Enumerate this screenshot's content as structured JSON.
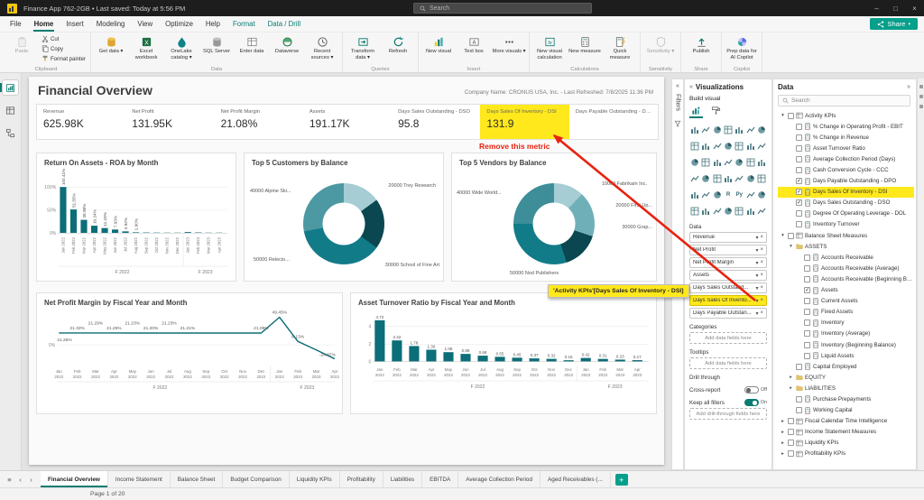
{
  "colors": {
    "accent": "#0a7c71",
    "share_button": "#069f8c",
    "highlight": "#ffe81c",
    "annotation": "#e8220f",
    "chart_main": "#0b6e78"
  },
  "titlebar": {
    "title": "Finance App 762-2GB • Last saved: Today at 5:56 PM",
    "search_placeholder": "Search"
  },
  "menubar": {
    "tabs": [
      {
        "label": "File"
      },
      {
        "label": "Home",
        "active": true
      },
      {
        "label": "Insert"
      },
      {
        "label": "Modeling"
      },
      {
        "label": "View"
      },
      {
        "label": "Optimize"
      },
      {
        "label": "Help"
      },
      {
        "label": "Format",
        "contextual": true
      },
      {
        "label": "Data / Drill",
        "contextual": true
      }
    ],
    "share_label": "Share"
  },
  "ribbon": {
    "groups": [
      {
        "label": "Clipboard",
        "items": [
          {
            "type": "big",
            "label": "Paste",
            "icon": "paste",
            "disabled": true
          },
          {
            "type": "small",
            "label": "Cut",
            "icon": "cut"
          },
          {
            "type": "small",
            "label": "Copy",
            "icon": "copy"
          },
          {
            "type": "small",
            "label": "Format painter",
            "icon": "format-painter"
          }
        ]
      },
      {
        "label": "Data",
        "items": [
          {
            "type": "big",
            "label": "Get data",
            "icon": "get-data",
            "dropdown": true
          },
          {
            "type": "big",
            "label": "Excel workbook",
            "icon": "excel"
          },
          {
            "type": "big",
            "label": "OneLake catalog",
            "icon": "onelake",
            "dropdown": true
          },
          {
            "type": "big",
            "label": "SQL Server",
            "icon": "sql-server"
          },
          {
            "type": "big",
            "label": "Enter data",
            "icon": "enter-data"
          },
          {
            "type": "big",
            "label": "Dataverse",
            "icon": "dataverse"
          },
          {
            "type": "big",
            "label": "Recent sources",
            "icon": "recent-sources",
            "dropdown": true
          }
        ]
      },
      {
        "label": "Queries",
        "items": [
          {
            "type": "big",
            "label": "Transform data",
            "icon": "transform-data",
            "dropdown": true
          },
          {
            "type": "big",
            "label": "Refresh",
            "icon": "refresh"
          }
        ]
      },
      {
        "label": "Insert",
        "items": [
          {
            "type": "big",
            "label": "New visual",
            "icon": "new-visual"
          },
          {
            "type": "big",
            "label": "Text box",
            "icon": "text-box"
          },
          {
            "type": "big",
            "label": "More visuals",
            "icon": "more-visuals",
            "dropdown": true
          }
        ]
      },
      {
        "label": "Calculations",
        "items": [
          {
            "type": "big",
            "label": "New visual calculation",
            "icon": "visual-calculation"
          },
          {
            "type": "big",
            "label": "New measure",
            "icon": "new-measure"
          },
          {
            "type": "big",
            "label": "Quick measure",
            "icon": "quick-measure"
          }
        ]
      },
      {
        "label": "Sensitivity",
        "items": [
          {
            "type": "big",
            "label": "Sensitivity",
            "icon": "sensitivity",
            "disabled": true,
            "dropdown": true
          }
        ]
      },
      {
        "label": "Share",
        "items": [
          {
            "type": "big",
            "label": "Publish",
            "icon": "publish"
          }
        ]
      },
      {
        "label": "Copilot",
        "items": [
          {
            "type": "big",
            "label": "Prep data for AI Copilot",
            "icon": "copilot"
          }
        ]
      }
    ]
  },
  "report": {
    "page_title": "Financial Overview",
    "company_line": "Company Name: CRONUS USA, Inc.  -  Last Refreshed: 7/8/2025 11:36 PM"
  },
  "kpis": [
    {
      "label": "Revenue",
      "value": "625.98K"
    },
    {
      "label": "Net Profit",
      "value": "131.95K"
    },
    {
      "label": "Net Profit Margin",
      "value": "21.08%"
    },
    {
      "label": "Assets",
      "value": "191.17K"
    },
    {
      "label": "Days Sales Outstanding - DSO",
      "value": "95.8"
    },
    {
      "label": "Days Sales Of Inventory - DSI",
      "value": "131.9",
      "highlighted": true
    },
    {
      "label": "Days Payable Outstanding - DPO",
      "value": ""
    }
  ],
  "annotation": {
    "text": "Remove this metric"
  },
  "tooltip": {
    "text": "'Activity KPIs'[Days Sales Of Inventory - DSI]"
  },
  "chart_data": [
    {
      "type": "bar",
      "title": "Return On Assets - ROA by Month",
      "ylabel": "ROA",
      "y_ticks": [
        "100%",
        "50%",
        "0%"
      ],
      "categories": [
        "Jan 2022",
        "Feb 2022",
        "Mar 2022",
        "Apr 2022",
        "May 2022",
        "Jun 2022",
        "Jul 2022",
        "Aug 2022",
        "Sep 2022",
        "Oct 2022",
        "Nov 2022",
        "Dec 2022",
        "Jan 2023",
        "Feb 2023",
        "Mar 2023",
        "Apr 2023"
      ],
      "values": [
        100.41,
        51.55,
        28.98,
        16.24,
        11.18,
        7.93,
        3.92,
        1.9,
        1.55,
        1.35,
        1.2,
        1.05,
        2.4,
        1.6,
        1.1,
        0.75
      ],
      "labels": [
        "100.41%",
        "51.55%",
        "28.98%",
        "16.24%",
        "11.18%",
        "7.93%",
        "3.92%",
        "1.90%",
        "",
        "",
        "",
        "",
        "",
        "",
        "",
        ""
      ],
      "fiscal_groups": [
        {
          "label": "F 2022",
          "from": 0,
          "to": 11
        },
        {
          "label": "F 2023",
          "from": 12,
          "to": 15
        }
      ]
    },
    {
      "type": "donut",
      "title": "Top 5 Customers by Balance",
      "slices": [
        {
          "label": "20000 Trey Research",
          "value": 15,
          "color": "#a5cdd3"
        },
        {
          "label": "30000 School of Fine Art",
          "value": 20,
          "color": "#0b4750"
        },
        {
          "label": "50000 Relecio...",
          "value": 37,
          "color": "#127b88"
        },
        {
          "label": "40000 Alpine Ski...",
          "value": 28,
          "color": "#4d99a3"
        }
      ]
    },
    {
      "type": "donut",
      "title": "Top 5 Vendors by Balance",
      "slices": [
        {
          "label": "10000 Fabrikam Inc.",
          "value": 12,
          "color": "#a5cdd3"
        },
        {
          "label": "20000 First Up...",
          "value": 18,
          "color": "#6fb0b8"
        },
        {
          "label": "30000 Grap...",
          "value": 15,
          "color": "#0b4750"
        },
        {
          "label": "50000 Nod Publishers",
          "value": 30,
          "color": "#127b88"
        },
        {
          "label": "40000 Wide World...",
          "value": 25,
          "color": "#3d8e99"
        }
      ]
    },
    {
      "type": "line",
      "title": "Net Profit Margin by Fiscal Year and Month",
      "y_ticks": [
        "0%"
      ],
      "ylim": [
        -30,
        55
      ],
      "categories": [
        "Jan 2022",
        "Feb 2022",
        "Mar 2022",
        "Apr 2022",
        "May 2022",
        "Jun 2022",
        "Jul 2022",
        "Aug 2022",
        "Sep 2022",
        "Oct 2022",
        "Nov 2022",
        "Dec 2022",
        "Jan 2023",
        "Feb 2023",
        "Mar 2023",
        "Apr 2023"
      ],
      "values": [
        21.26,
        21.32,
        21.29,
        21.25,
        21.23,
        21.2,
        21.23,
        21.21,
        21.22,
        21.23,
        21.21,
        21.09,
        49.45,
        6.13,
        -9.0,
        -24.97
      ],
      "labels": [
        "21.26%",
        "21.32%",
        "21.29%",
        "21.25%",
        "21.23%",
        "21.20%",
        "21.23%",
        "21.21%",
        "",
        "",
        "",
        "21.09%",
        "49.45%",
        "6.13%",
        "",
        "-24.97%"
      ],
      "fiscal_groups": [
        {
          "label": "F 2022",
          "from": 0,
          "to": 11
        },
        {
          "label": "F 2023",
          "from": 12,
          "to": 15
        }
      ]
    },
    {
      "type": "bar",
      "title": "Asset Turnover Ratio by Fiscal Year and Month",
      "y_ticks": [
        "4",
        "2",
        "0"
      ],
      "categories": [
        "Jan 2022",
        "Feb 2022",
        "Mar 2022",
        "Apr 2022",
        "May 2022",
        "Jun 2022",
        "Jul 2022",
        "Aug 2022",
        "Sep 2022",
        "Oct 2022",
        "Nov 2022",
        "Dec 2022",
        "Jan 2023",
        "Feb 2023",
        "Mar 2023",
        "Apr 2023"
      ],
      "values": [
        4.72,
        2.42,
        1.78,
        1.36,
        1.08,
        0.88,
        0.68,
        0.55,
        0.45,
        0.37,
        0.32,
        0.16,
        0.42,
        0.31,
        0.23,
        0.17
      ],
      "labels": [
        "4.72",
        "2.42",
        "1.78",
        "1.36",
        "1.08",
        "0.88",
        "0.68",
        "0.55",
        "0.45",
        "0.37",
        "0.32",
        "0.16",
        "0.42",
        "0.31",
        "0.23",
        "0.17"
      ],
      "fiscal_groups": [
        {
          "label": "F 2022",
          "from": 0,
          "to": 11
        },
        {
          "label": "F 2023",
          "from": 12,
          "to": 15
        }
      ]
    }
  ],
  "filters_pane": {
    "title": "Filters"
  },
  "viz_panel": {
    "title": "Visualizations",
    "build_label": "Build visual",
    "visual_icons": [
      "stacked-bar-chart",
      "stacked-column-chart",
      "clustered-bar-chart",
      "clustered-column-chart",
      "100-stacked-bar-chart",
      "100-stacked-column-chart",
      "line-chart",
      "area-chart",
      "stacked-area-chart",
      "line-and-stacked-column-chart",
      "line-and-clustered-column-chart",
      "ribbon-chart",
      "waterfall-chart",
      "funnel-chart",
      "scatter-chart",
      "pie-chart",
      "donut-chart",
      "treemap",
      "map",
      "filled-map",
      "shape-map",
      "azure-map",
      "gauge",
      "card",
      "new-card",
      "multi-row-card",
      "kpi",
      "slicer",
      "new-slicer",
      "table",
      "matrix",
      "r-script-visual",
      "python-visual",
      "key-influencers",
      "decomposition-tree",
      "q-and-a",
      "smart-narrative",
      "metrics",
      "paginated-report",
      "arcgis-map",
      "power-apps",
      "power-automate"
    ],
    "data_section_label": "Data",
    "fields": [
      {
        "label": "Revenue"
      },
      {
        "label": "Net Profit"
      },
      {
        "label": "Net Profit Margin"
      },
      {
        "label": "Assets"
      },
      {
        "label": "Days Sales Outstand..."
      },
      {
        "label": "Days Sales Of Invento...",
        "highlighted": true
      },
      {
        "label": "Days Payable Outstan..."
      }
    ],
    "categories_label": "Categories",
    "add_fields_placeholder": "Add data fields here",
    "tooltips_label": "Tooltips",
    "drill_through_label": "Drill through",
    "cross_report_label": "Cross-report",
    "cross_report_state": "Off",
    "keep_filters_label": "Keep all filters",
    "keep_filters_state": "On",
    "drill_placeholder": "Add drill-through fields here"
  },
  "data_panel": {
    "title": "Data",
    "search_placeholder": "Search",
    "tree": [
      {
        "label": "Activity KPIs",
        "icon": "table",
        "expander": "open",
        "checkbox": true,
        "level": 0
      },
      {
        "label": "% Change in Operating Profit - EBIT",
        "icon": "measure",
        "checkbox": true,
        "level": 1
      },
      {
        "label": "% Change in Revenue",
        "icon": "measure",
        "checkbox": true,
        "level": 1
      },
      {
        "label": "Asset Turnover Ratio",
        "icon": "measure",
        "checkbox": true,
        "level": 1
      },
      {
        "label": "Average Collection Period (Days)",
        "icon": "measure",
        "checkbox": true,
        "level": 1
      },
      {
        "label": "Cash Conversion Cycle - CCC",
        "icon": "measure",
        "checkbox": true,
        "level": 1
      },
      {
        "label": "Days Payable Outstanding - DPO",
        "icon": "measure",
        "checkbox": true,
        "checked": true,
        "level": 1
      },
      {
        "label": "Days Sales Of Inventory - DSI",
        "icon": "measure",
        "checkbox": true,
        "checked": true,
        "highlighted": true,
        "level": 1
      },
      {
        "label": "Days Sales Outstanding - DSO",
        "icon": "measure",
        "checkbox": true,
        "checked": true,
        "level": 1
      },
      {
        "label": "Degree Of Operating Leverage - DOL",
        "icon": "measure",
        "checkbox": true,
        "level": 1
      },
      {
        "label": "Inventory Turnover",
        "icon": "measure",
        "checkbox": true,
        "level": 1
      },
      {
        "label": "Balance Sheet Measures",
        "icon": "table",
        "expander": "open",
        "checkbox": true,
        "level": 0
      },
      {
        "label": "ASSETS",
        "icon": "folder",
        "expander": "open",
        "level": 1
      },
      {
        "label": "Accounts Receivable",
        "icon": "measure",
        "checkbox": true,
        "level": 2
      },
      {
        "label": "Accounts Receivable (Average)",
        "icon": "measure",
        "checkbox": true,
        "level": 2
      },
      {
        "label": "Accounts Receivable (Beginning Bal...",
        "icon": "measure",
        "checkbox": true,
        "level": 2
      },
      {
        "label": "Assets",
        "icon": "measure",
        "checkbox": true,
        "checked": true,
        "level": 2
      },
      {
        "label": "Current Assets",
        "icon": "measure",
        "checkbox": true,
        "level": 2
      },
      {
        "label": "Fixed Assets",
        "icon": "measure",
        "checkbox": true,
        "level": 2
      },
      {
        "label": "Inventory",
        "icon": "measure",
        "checkbox": true,
        "level": 2
      },
      {
        "label": "Inventory (Average)",
        "icon": "measure",
        "checkbox": true,
        "level": 2
      },
      {
        "label": "Inventory (Beginning Balance)",
        "icon": "measure",
        "checkbox": true,
        "level": 2
      },
      {
        "label": "Liquid Assets",
        "icon": "measure",
        "checkbox": true,
        "level": 2
      },
      {
        "label": "Capital Employed",
        "icon": "measure",
        "checkbox": true,
        "level": 1
      },
      {
        "label": "EQUITY",
        "icon": "folder",
        "expander": "closed",
        "level": 1
      },
      {
        "label": "LIABILITIES",
        "icon": "folder",
        "expander": "closed",
        "level": 1
      },
      {
        "label": "Purchase Prepayments",
        "icon": "measure",
        "checkbox": true,
        "level": 1
      },
      {
        "label": "Working Capital",
        "icon": "measure",
        "checkbox": true,
        "level": 1
      },
      {
        "label": "Fiscal Calendar Time Intelligence",
        "icon": "table",
        "expander": "closed",
        "checkbox": true,
        "level": 0
      },
      {
        "label": "Income Statement Measures",
        "icon": "table",
        "expander": "closed",
        "checkbox": true,
        "level": 0
      },
      {
        "label": "Liquidity KPIs",
        "icon": "table",
        "expander": "closed",
        "checkbox": true,
        "level": 0
      },
      {
        "label": "Profitability KPIs",
        "icon": "table",
        "expander": "closed",
        "checkbox": true,
        "level": 0
      }
    ]
  },
  "page_tabs": [
    {
      "label": "Financial Overview",
      "active": true
    },
    {
      "label": "Income Statement"
    },
    {
      "label": "Balance Sheet"
    },
    {
      "label": "Budget Comparison"
    },
    {
      "label": "Liquidity KPIs"
    },
    {
      "label": "Profitability"
    },
    {
      "label": "Liabilities"
    },
    {
      "label": "EBITDA"
    },
    {
      "label": "Average Collection Period"
    },
    {
      "label": "Aged Receivables (..."
    }
  ],
  "status": {
    "page_indicator": "Page 1 of 20"
  }
}
